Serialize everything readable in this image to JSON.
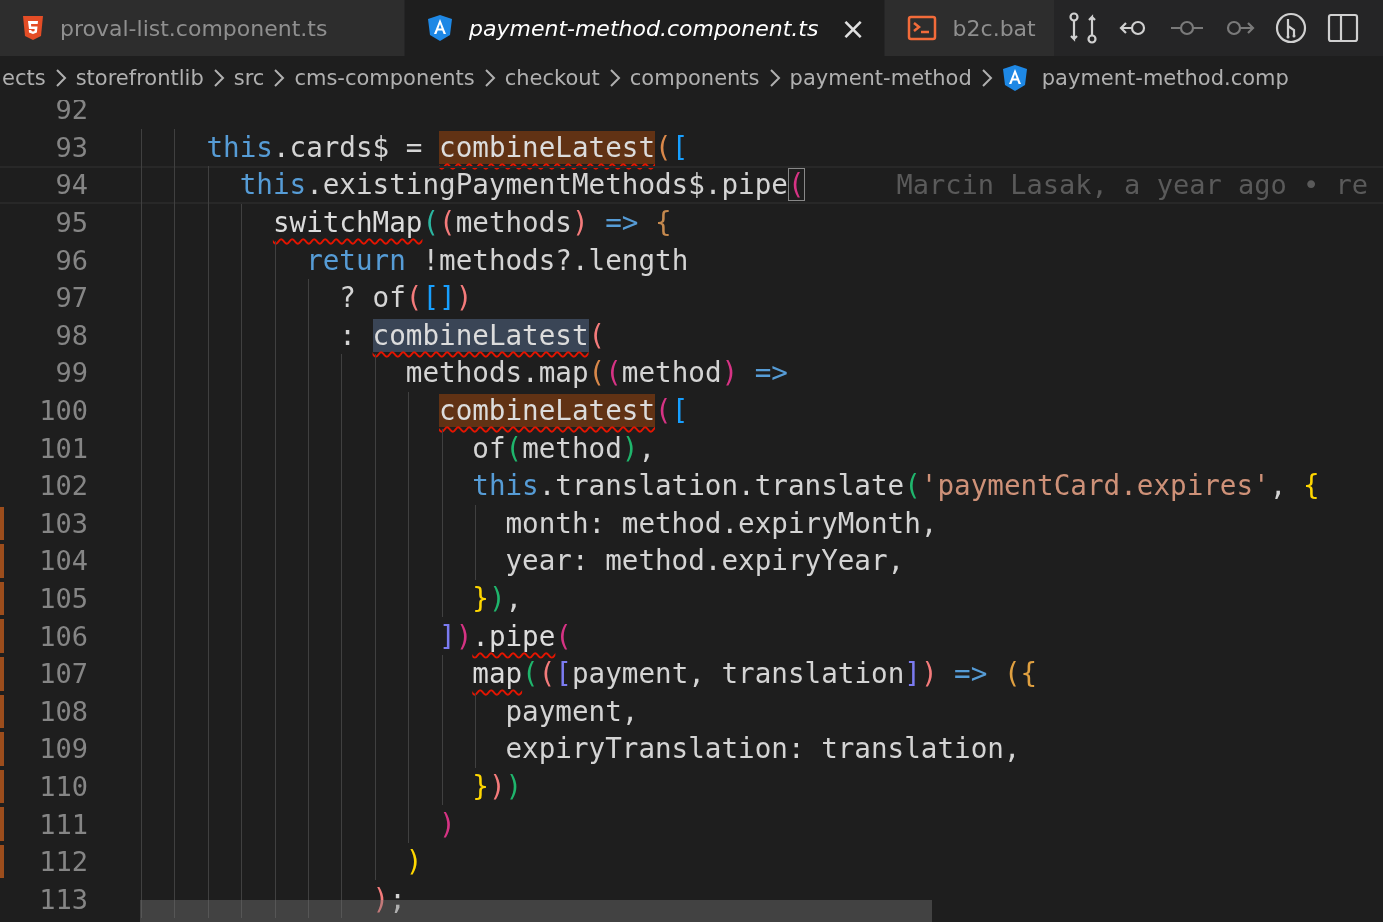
{
  "tabs": [
    {
      "label": "proval-list.component.ts",
      "kind": "html",
      "selected": false
    },
    {
      "label": "payment-method.component.ts",
      "kind": "angular",
      "selected": true,
      "close": "×"
    },
    {
      "label": "b2c.bat",
      "kind": "terminal",
      "selected": false
    }
  ],
  "toolbar": [
    {
      "kind": "compare"
    },
    {
      "kind": "back"
    },
    {
      "kind": "commit",
      "disabled": true
    },
    {
      "kind": "forward",
      "disabled": true
    },
    {
      "kind": "graph"
    },
    {
      "kind": "split"
    }
  ],
  "breadcrumbs": [
    {
      "label": "ects",
      "kind": "folder"
    },
    {
      "label": "storefrontlib",
      "kind": "folder"
    },
    {
      "label": "src",
      "kind": "folder"
    },
    {
      "label": "cms-components",
      "kind": "folder"
    },
    {
      "label": "checkout",
      "kind": "folder"
    },
    {
      "label": "components",
      "kind": "folder"
    },
    {
      "label": "payment-method",
      "kind": "folder"
    },
    {
      "label": "payment-method.comp",
      "kind": "angular"
    }
  ],
  "lines": [
    {
      "number": "92",
      "changed": false
    },
    {
      "number": "93",
      "changed": false,
      "tokens": [
        {
          "kind": "kw",
          "text": "    this"
        },
        {
          "kind": "id",
          "text": ".cards$ = "
        },
        {
          "kind": "fn",
          "text": "combineLatest",
          "highlight": true,
          "underline": true
        },
        {
          "kind": "br",
          "text": "(",
          "color": "#d9884a"
        },
        {
          "kind": "br",
          "text": "[",
          "color": "#179fff"
        }
      ]
    },
    {
      "number": "94",
      "changed": false,
      "current": true,
      "blame": "Marcin Lasak, a year ago • re",
      "tokens": [
        {
          "kind": "kw",
          "text": "      this"
        },
        {
          "kind": "id",
          "text": ".existingPaymentMethods$.pipe"
        },
        {
          "kind": "br",
          "text": "(",
          "color": "#d63384",
          "boxed": true
        }
      ]
    },
    {
      "number": "95",
      "changed": false,
      "tokens": [
        {
          "kind": "fn",
          "text": "        switchMap",
          "underline": true
        },
        {
          "kind": "br",
          "text": "(",
          "color": "#2bb5a0"
        },
        {
          "kind": "br",
          "text": "(",
          "color": "#f47b7b"
        },
        {
          "kind": "id",
          "text": "methods"
        },
        {
          "kind": "br",
          "text": ")",
          "color": "#f47b7b"
        },
        {
          "kind": "op",
          "text": " => "
        },
        {
          "kind": "br",
          "text": "{",
          "color": "#c5894e"
        }
      ]
    },
    {
      "number": "96",
      "changed": false,
      "tokens": [
        {
          "kind": "kw",
          "text": "          return"
        },
        {
          "kind": "id",
          "text": " !methods?.length"
        }
      ]
    },
    {
      "number": "97",
      "changed": false,
      "tokens": [
        {
          "kind": "id",
          "text": "            ? of"
        },
        {
          "kind": "br",
          "text": "(",
          "color": "#f47b7b"
        },
        {
          "kind": "br",
          "text": "[]",
          "color": "#179fff"
        },
        {
          "kind": "br",
          "text": ")",
          "color": "#f47b7b"
        }
      ]
    },
    {
      "number": "98",
      "changed": false,
      "tokens": [
        {
          "kind": "id",
          "text": "            : "
        },
        {
          "kind": "fn",
          "text": "combineLatest",
          "selected": true,
          "underline": true
        },
        {
          "kind": "br",
          "text": "(",
          "color": "#f47b7b"
        }
      ]
    },
    {
      "number": "99",
      "changed": false,
      "tokens": [
        {
          "kind": "id",
          "text": "                methods.map"
        },
        {
          "kind": "br",
          "text": "(",
          "color": "#d9884a"
        },
        {
          "kind": "br",
          "text": "(",
          "color": "#d63384"
        },
        {
          "kind": "id",
          "text": "method"
        },
        {
          "kind": "br",
          "text": ")",
          "color": "#d63384"
        },
        {
          "kind": "op",
          "text": " =>"
        }
      ]
    },
    {
      "number": "100",
      "changed": false,
      "tokens": [
        {
          "kind": "fn",
          "text": "                  combineLatest",
          "highlight": true,
          "underline": true
        },
        {
          "kind": "br",
          "text": "(",
          "color": "#d63384"
        },
        {
          "kind": "br",
          "text": "[",
          "color": "#179fff"
        }
      ]
    },
    {
      "number": "101",
      "changed": false,
      "tokens": [
        {
          "kind": "id",
          "text": "                    of"
        },
        {
          "kind": "br",
          "text": "(",
          "color": "#1fb56c"
        },
        {
          "kind": "id",
          "text": "method"
        },
        {
          "kind": "br",
          "text": ")",
          "color": "#1fb56c"
        },
        {
          "kind": "id",
          "text": ","
        }
      ]
    },
    {
      "number": "102",
      "changed": false,
      "tokens": [
        {
          "kind": "kw",
          "text": "                    this"
        },
        {
          "kind": "id",
          "text": ".translation.translate"
        },
        {
          "kind": "br",
          "text": "(",
          "color": "#1fb56c"
        },
        {
          "kind": "str",
          "text": "'paymentCard.expires'"
        },
        {
          "kind": "id",
          "text": ", "
        },
        {
          "kind": "br",
          "text": "{",
          "color": "#ffd700"
        }
      ]
    },
    {
      "number": "103",
      "changed": true,
      "tokens": [
        {
          "kind": "id",
          "text": "                      month: method.expiryMonth,"
        }
      ]
    },
    {
      "number": "104",
      "changed": true,
      "tokens": [
        {
          "kind": "id",
          "text": "                      year: method.expiryYear,"
        }
      ]
    },
    {
      "number": "105",
      "changed": true,
      "tokens": [
        {
          "kind": "br",
          "text": "                    }",
          "color": "#ffd700"
        },
        {
          "kind": "br",
          "text": ")",
          "color": "#1fb56c"
        },
        {
          "kind": "id",
          "text": ","
        }
      ]
    },
    {
      "number": "106",
      "changed": true,
      "tokens": [
        {
          "kind": "br",
          "text": "                  ]",
          "color": "#7b7bf0"
        },
        {
          "kind": "br",
          "text": ")",
          "color": "#d63384"
        },
        {
          "kind": "fn",
          "text": ".pipe",
          "underline": true
        },
        {
          "kind": "br",
          "text": "(",
          "color": "#d63384"
        }
      ]
    },
    {
      "number": "107",
      "changed": true,
      "tokens": [
        {
          "kind": "fn",
          "text": "                    map",
          "underline": true
        },
        {
          "kind": "br",
          "text": "(",
          "color": "#1fb56c"
        },
        {
          "kind": "br",
          "text": "(",
          "color": "#f47b7b"
        },
        {
          "kind": "br",
          "text": "[",
          "color": "#7b7bf0"
        },
        {
          "kind": "id",
          "text": "payment, translation"
        },
        {
          "kind": "br",
          "text": "]",
          "color": "#7b7bf0"
        },
        {
          "kind": "br",
          "text": ")",
          "color": "#f47b7b"
        },
        {
          "kind": "op",
          "text": " => "
        },
        {
          "kind": "br",
          "text": "({",
          "color": "#e0a040"
        }
      ]
    },
    {
      "number": "108",
      "changed": true,
      "tokens": [
        {
          "kind": "id",
          "text": "                      payment,"
        }
      ]
    },
    {
      "number": "109",
      "changed": true,
      "tokens": [
        {
          "kind": "id",
          "text": "                      expiryTranslation: translation,"
        }
      ]
    },
    {
      "number": "110",
      "changed": true,
      "tokens": [
        {
          "kind": "br",
          "text": "                    }",
          "color": "#ffd700"
        },
        {
          "kind": "br",
          "text": ")",
          "color": "#f47b7b"
        },
        {
          "kind": "br",
          "text": ")",
          "color": "#1fb56c"
        }
      ]
    },
    {
      "number": "111",
      "changed": true,
      "tokens": [
        {
          "kind": "br",
          "text": "                  )",
          "color": "#d63384"
        }
      ]
    },
    {
      "number": "112",
      "changed": true,
      "tokens": [
        {
          "kind": "br",
          "text": "                )",
          "color": "#ffd700"
        }
      ]
    },
    {
      "number": "113",
      "changed": false,
      "tokens": [
        {
          "kind": "br",
          "text": "              )",
          "color": "#f47b7b"
        },
        {
          "kind": "id",
          "text": ";"
        }
      ]
    }
  ]
}
